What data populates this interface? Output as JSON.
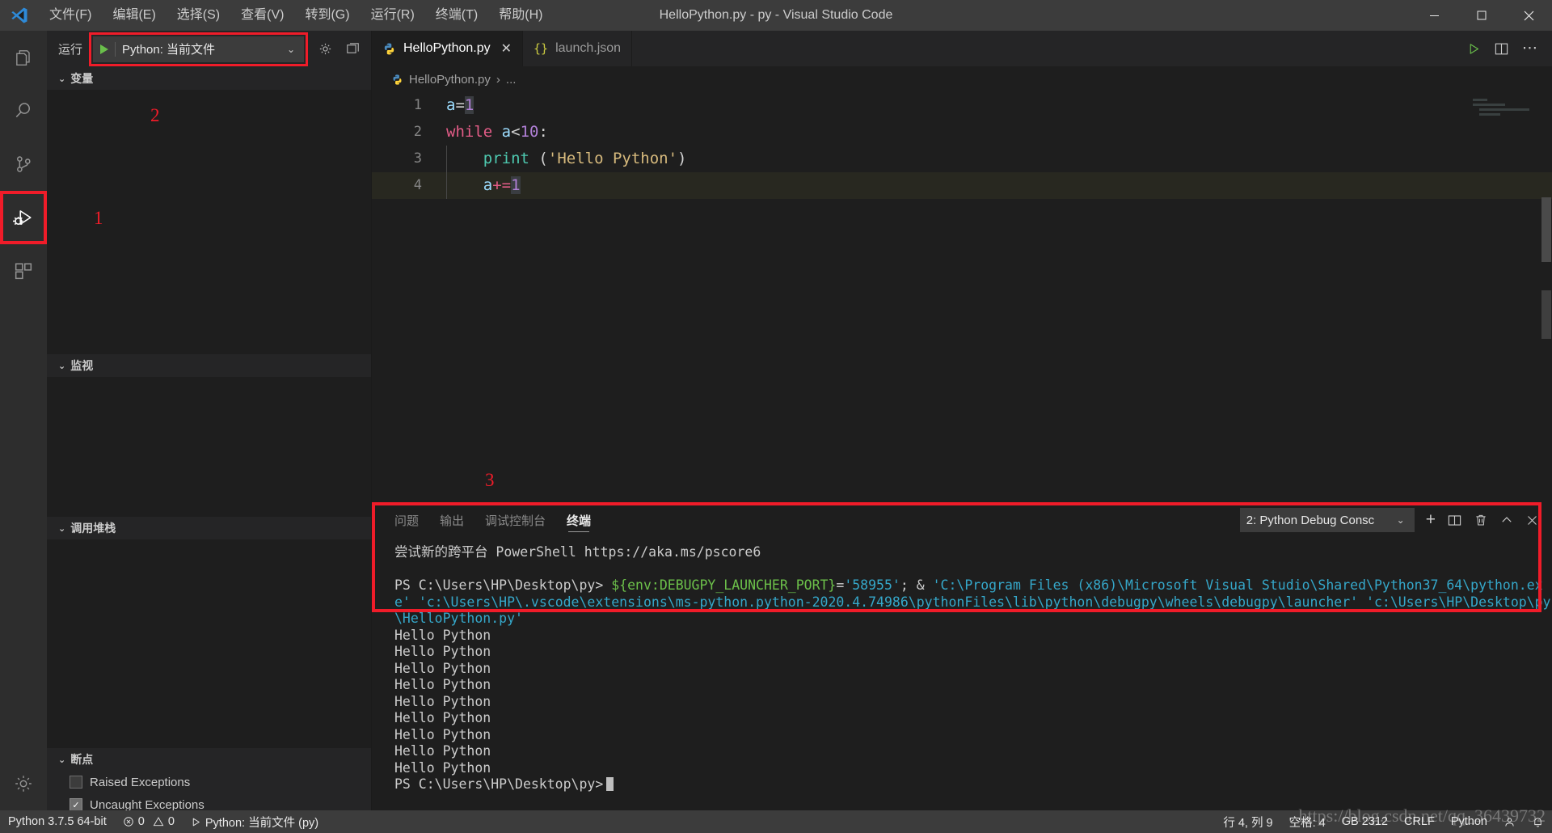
{
  "titlebar": {
    "logo_icon": "vscode-logo-icon",
    "menus": [
      {
        "label": "文件(F)"
      },
      {
        "label": "编辑(E)"
      },
      {
        "label": "选择(S)"
      },
      {
        "label": "查看(V)"
      },
      {
        "label": "转到(G)"
      },
      {
        "label": "运行(R)"
      },
      {
        "label": "终端(T)"
      },
      {
        "label": "帮助(H)"
      }
    ],
    "window_title": "HelloPython.py - py - Visual Studio Code",
    "controls": {
      "minimize": "─",
      "maximize": "☐",
      "close": "✕"
    }
  },
  "activitybar": {
    "items": [
      {
        "name": "explorer",
        "icon": "files-icon"
      },
      {
        "name": "search",
        "icon": "search-icon"
      },
      {
        "name": "source-control",
        "icon": "source-control-icon"
      },
      {
        "name": "run-and-debug",
        "icon": "run-debug-icon",
        "active": true
      },
      {
        "name": "extensions",
        "icon": "extensions-icon"
      }
    ],
    "bottom": [
      {
        "name": "manage",
        "icon": "gear-icon"
      }
    ]
  },
  "sidebar": {
    "title": "运行",
    "run_config": {
      "label": "Python: 当前文件",
      "play_icon": "play-icon",
      "chevron": "⌄"
    },
    "gear_icon": "gear-icon",
    "open_debug_console_icon": "open-console-icon",
    "sections": [
      {
        "name": "variables",
        "label": "变量",
        "chevron": "⌄"
      },
      {
        "name": "watch",
        "label": "监视",
        "chevron": "⌄"
      },
      {
        "name": "call-stack",
        "label": "调用堆栈",
        "chevron": "⌄"
      },
      {
        "name": "breakpoints",
        "label": "断点",
        "chevron": "⌄"
      }
    ],
    "breakpoints": [
      {
        "label": "Raised Exceptions",
        "checked": false
      },
      {
        "label": "Uncaught Exceptions",
        "checked": true
      }
    ]
  },
  "markers": [
    {
      "id": "1",
      "text": "1"
    },
    {
      "id": "2",
      "text": "2"
    },
    {
      "id": "3",
      "text": "3"
    }
  ],
  "editor": {
    "tabs": [
      {
        "label": "HelloPython.py",
        "icon": "python-file-icon",
        "active": true,
        "close": "✕"
      },
      {
        "label": "launch.json",
        "icon": "json-file-icon",
        "active": false
      }
    ],
    "tab_actions": [
      {
        "name": "run-file",
        "icon": "play-icon"
      },
      {
        "name": "split-editor",
        "icon": "split-editor-icon"
      },
      {
        "name": "more-actions",
        "icon": "ellipsis-icon"
      }
    ],
    "breadcrumb": {
      "file": "HelloPython.py",
      "separator": "›",
      "tail": "..."
    },
    "lines": [
      {
        "num": "1",
        "text": "a=1"
      },
      {
        "num": "2",
        "text": "while a<10:"
      },
      {
        "num": "3",
        "text": "    print ('Hello Python')"
      },
      {
        "num": "4",
        "text": "    a+=1"
      }
    ]
  },
  "panel": {
    "tabs": [
      {
        "label": "问题",
        "active": false
      },
      {
        "label": "输出",
        "active": false
      },
      {
        "label": "调试控制台",
        "active": false
      },
      {
        "label": "终端",
        "active": true
      }
    ],
    "terminal_select": {
      "label": "2: Python Debug Consc",
      "chevron": "⌄"
    },
    "actions": [
      {
        "name": "new-terminal",
        "icon": "plus-icon",
        "glyph": "＋"
      },
      {
        "name": "split-terminal",
        "icon": "split-icon"
      },
      {
        "name": "kill-terminal",
        "icon": "trash-icon"
      },
      {
        "name": "maximize-panel",
        "icon": "chevron-up-icon",
        "glyph": "⌃"
      },
      {
        "name": "close-panel",
        "icon": "close-icon",
        "glyph": "✕"
      }
    ],
    "terminal": {
      "intro": "尝试新的跨平台 PowerShell https://aka.ms/pscore6",
      "prompt1": "PS C:\\Users\\HP\\Desktop\\py> ",
      "cmd_env": "${env:DEBUGPY_LAUNCHER_PORT}",
      "cmd_eq": "=",
      "cmd_port": "'58955'",
      "cmd_sep": "; & ",
      "cmd_python": "'C:\\Program Files (x86)\\Microsoft Visual Studio\\Shared\\Python37_64\\python.exe'",
      "cmd_launcher": "'c:\\Users\\HP\\.vscode\\extensions\\ms-python.python-2020.4.74986\\pythonFiles\\lib\\python\\debugpy\\wheels\\debugpy\\launcher'",
      "cmd_script": "'c:\\Users\\HP\\Desktop\\py\\HelloPython.py'",
      "output_lines": [
        "Hello Python",
        "Hello Python",
        "Hello Python",
        "Hello Python",
        "Hello Python",
        "Hello Python",
        "Hello Python",
        "Hello Python",
        "Hello Python"
      ],
      "prompt2": "PS C:\\Users\\HP\\Desktop\\py>"
    }
  },
  "statusbar": {
    "left": [
      {
        "name": "python-interpreter",
        "label": "Python 3.7.5 64-bit"
      },
      {
        "name": "errors-warnings",
        "errors": "0",
        "warnings": "0"
      },
      {
        "name": "run-config",
        "label": "Python: 当前文件 (py)"
      }
    ],
    "right": [
      {
        "name": "cursor-position",
        "label": "行 4, 列 9"
      },
      {
        "name": "indentation",
        "label": "空格: 4"
      },
      {
        "name": "encoding",
        "label": "GB 2312"
      },
      {
        "name": "eol",
        "label": "CRLF"
      },
      {
        "name": "language-mode",
        "label": "Python"
      },
      {
        "name": "feedback",
        "icon": "smiley-icon"
      },
      {
        "name": "notifications",
        "icon": "bell-icon"
      }
    ],
    "watermark": "https://blog.csdn.net/qq_36439732"
  }
}
